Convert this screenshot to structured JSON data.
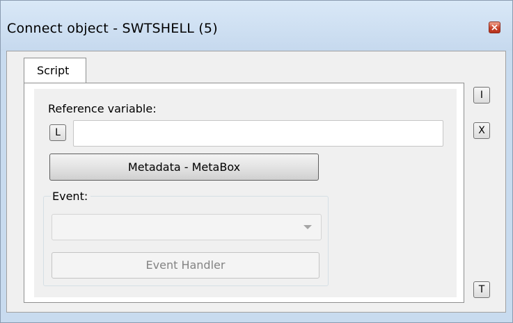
{
  "window": {
    "title": "Connect object - SWTSHELL (5)"
  },
  "tabs": [
    {
      "label": "Script",
      "selected": true
    }
  ],
  "form": {
    "reference_variable_label": "Reference variable:",
    "lookup_button_label": "L",
    "reference_variable_value": "",
    "metadata_button_label": "Metadata - MetaBox",
    "event_group_label": "Event:",
    "event_dropdown_value": "",
    "event_handler_button_label": "Event Handler"
  },
  "side_buttons": {
    "insert_label": "I",
    "delete_label": "X",
    "test_label": "T"
  },
  "colors": {
    "titlebar": "#c6d9ee",
    "close_button": "#c9432b",
    "disabled_text": "#838383"
  },
  "icons": {
    "close": "close-icon",
    "dropdown": "chevron-down-icon"
  }
}
